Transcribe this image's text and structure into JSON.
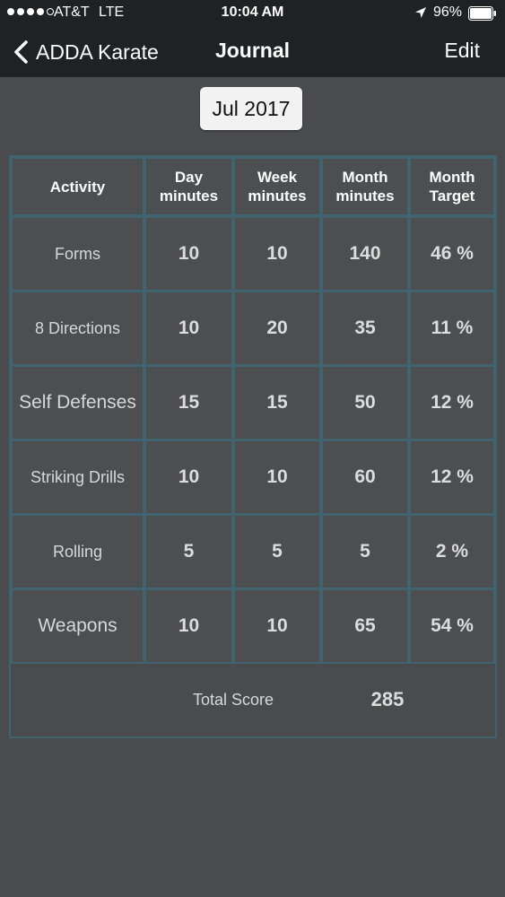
{
  "status_bar": {
    "carrier": "AT&T",
    "network": "LTE",
    "time": "10:04 AM",
    "battery": "96%"
  },
  "nav": {
    "back_label": "ADDA Karate",
    "title": "Journal",
    "edit_label": "Edit"
  },
  "month_selector": {
    "label": "Jul 2017"
  },
  "table": {
    "headers": {
      "activity": "Activity",
      "day": [
        "Day",
        "minutes"
      ],
      "week": [
        "Week",
        "minutes"
      ],
      "month": [
        "Month",
        "minutes"
      ],
      "target": [
        "Month",
        "Target"
      ]
    },
    "rows": [
      {
        "activity": "Forms",
        "day": "10",
        "week": "10",
        "month": "140",
        "target": "46 %"
      },
      {
        "activity": "8 Directions",
        "day": "10",
        "week": "20",
        "month": "35",
        "target": "11 %"
      },
      {
        "activity": "Self Defenses",
        "day": "15",
        "week": "15",
        "month": "50",
        "target": "12 %"
      },
      {
        "activity": "Striking Drills",
        "day": "10",
        "week": "10",
        "month": "60",
        "target": "12 %"
      },
      {
        "activity": "Rolling",
        "day": "5",
        "week": "5",
        "month": "5",
        "target": "2 %"
      },
      {
        "activity": "Weapons",
        "day": "10",
        "week": "10",
        "month": "65",
        "target": "54 %"
      }
    ],
    "total_label": "Total Score",
    "total_value": "285"
  },
  "colors": {
    "background": "#4a4b4d",
    "header_bg": "#1f2225",
    "grid_line": "#3f6470"
  },
  "icons": {
    "back": "chevron-left-icon",
    "location": "location-arrow-icon",
    "battery": "battery-icon"
  }
}
